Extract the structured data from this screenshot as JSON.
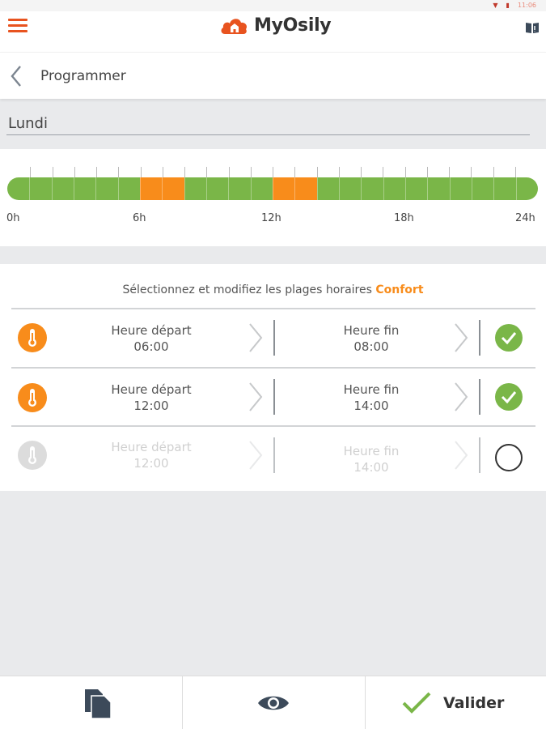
{
  "status": {
    "time": "11:06"
  },
  "app": {
    "brand": "MyOsily",
    "colors": {
      "accent": "#e8531f",
      "comfort": "#f88c1b",
      "eco": "#7ab648"
    }
  },
  "header": {
    "title": "Programmer"
  },
  "day": "Lundi",
  "timeline": {
    "axis_labels": [
      "0h",
      "6h",
      "12h",
      "18h",
      "24h"
    ],
    "range_hours": [
      0,
      24
    ],
    "comfort_ranges": [
      {
        "start": 6,
        "end": 8
      },
      {
        "start": 12,
        "end": 14
      }
    ]
  },
  "slots": {
    "title_prefix": "Sélectionnez et modifiez les plages horaires",
    "title_accent": "Confort",
    "items": [
      {
        "start_label": "Heure départ",
        "start": "06:00",
        "end_label": "Heure fin",
        "end": "08:00",
        "enabled": true
      },
      {
        "start_label": "Heure départ",
        "start": "12:00",
        "end_label": "Heure fin",
        "end": "14:00",
        "enabled": true
      },
      {
        "start_label": "Heure départ",
        "start": "12:00",
        "end_label": "Heure fin",
        "end": "14:00",
        "enabled": false
      }
    ]
  },
  "bottom": {
    "validate_label": "Valider"
  }
}
